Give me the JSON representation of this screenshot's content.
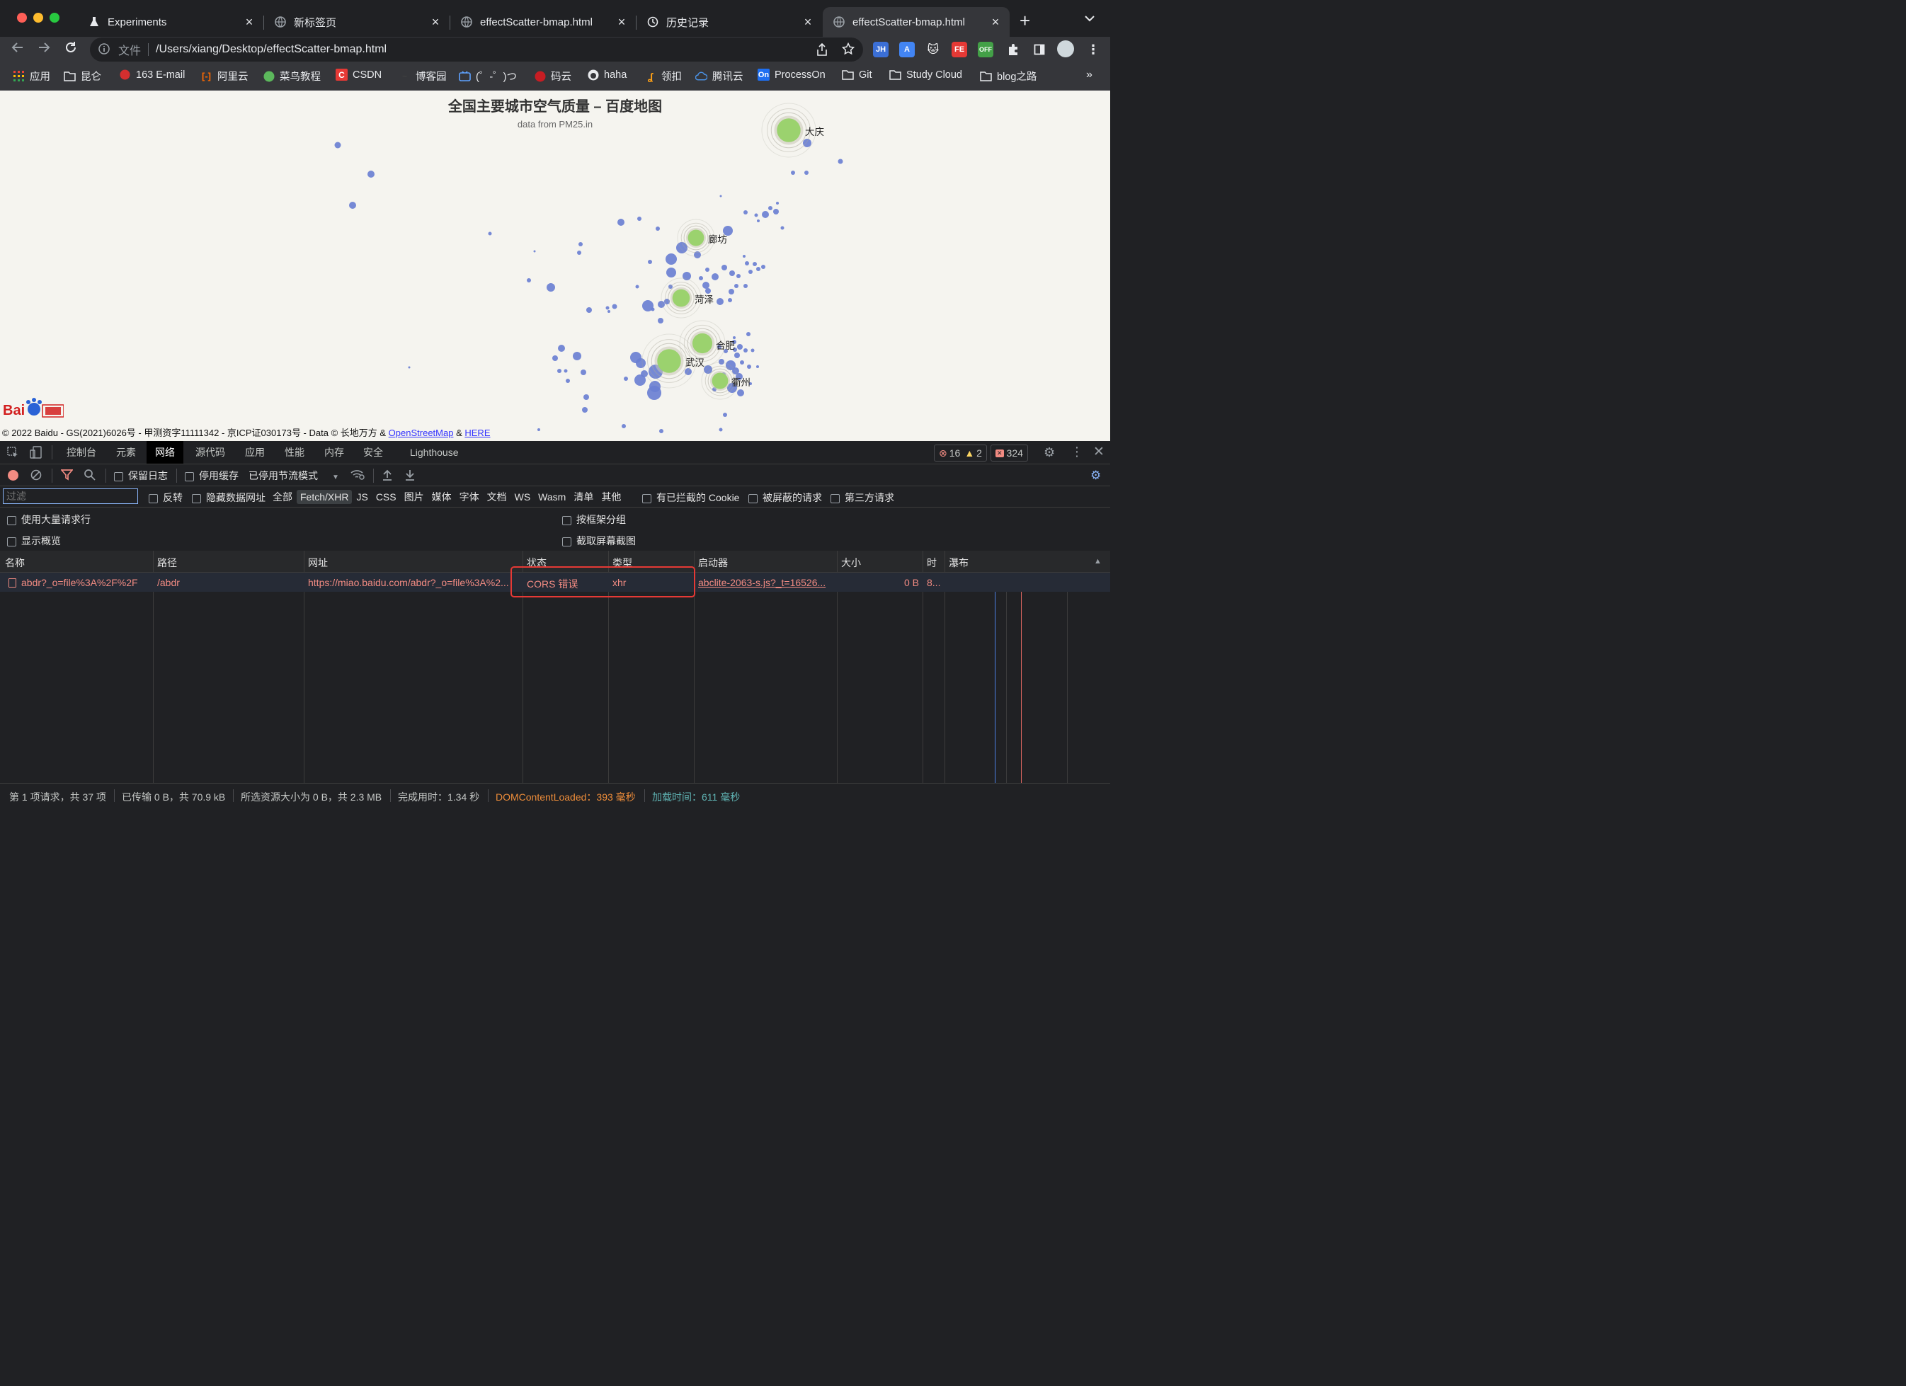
{
  "tabs": [
    {
      "title": "Experiments"
    },
    {
      "title": "新标签页"
    },
    {
      "title": "effectScatter-bmap.html"
    },
    {
      "title": "历史记录"
    },
    {
      "title": "effectScatter-bmap.html"
    }
  ],
  "toolbar": {
    "security_label": "文件",
    "url": "/Users/xiang/Desktop/effectScatter-bmap.html"
  },
  "bookmarks": [
    {
      "label": "应用"
    },
    {
      "label": "昆仑"
    },
    {
      "label": "163 E-mail"
    },
    {
      "label": "阿里云"
    },
    {
      "label": "菜鸟教程"
    },
    {
      "label": "CSDN"
    },
    {
      "label": "博客园"
    },
    {
      "label": "(゜-゜)つ"
    },
    {
      "label": "码云"
    },
    {
      "label": "haha"
    },
    {
      "label": "领扣"
    },
    {
      "label": "腾讯云"
    },
    {
      "label": "ProcessOn"
    },
    {
      "label": "Git"
    },
    {
      "label": "Study Cloud"
    },
    {
      "label": "blog之路"
    }
  ],
  "map": {
    "title": "全国主要城市空气质量 – 百度地图",
    "subtitle": "data from PM25.in",
    "copyright_text": "© 2022 Baidu - GS(2021)6026号 - 甲测资字11111342 - 京ICP证030173号 - Data © 长地万方 &",
    "copyright_link1": "OpenStreetMap",
    "copyright_amp": "&",
    "copyright_link2": "HERE",
    "logo_text": "Bai地图",
    "point_color": "#6a7fd3",
    "highlight_color": "#9bd26e",
    "top_cities": [
      {
        "name": "大庆"
      },
      {
        "name": "廊坊"
      },
      {
        "name": "菏泽"
      },
      {
        "name": "合肥"
      },
      {
        "name": "武汉"
      },
      {
        "name": "衢州"
      }
    ]
  },
  "devtools": {
    "tabs": [
      "控制台",
      "元素",
      "网络",
      "源代码",
      "应用",
      "性能",
      "内存",
      "安全",
      "Lighthouse"
    ],
    "active_tab": "网络",
    "badges": {
      "errors": "16",
      "warnings": "2",
      "issues": "324"
    },
    "network_toolbar": {
      "preserve_log": "保留日志",
      "disable_cache": "停用缓存",
      "throttle": "已停用节流模式"
    },
    "filter": {
      "placeholder": "过滤",
      "invert": "反转",
      "hide_data_urls": "隐藏数据网址",
      "types": [
        "全部",
        "Fetch/XHR",
        "JS",
        "CSS",
        "图片",
        "媒体",
        "字体",
        "文档",
        "WS",
        "Wasm",
        "清单",
        "其他"
      ],
      "active_type": "Fetch/XHR",
      "blocked_cookies": "有已拦截的 Cookie",
      "blocked_requests": "被屏蔽的请求",
      "third_party": "第三方请求"
    },
    "options": {
      "large_rows": "使用大量请求行",
      "group_by_frame": "按框架分组",
      "show_overview": "显示概览",
      "capture_screenshots": "截取屏幕截图"
    },
    "columns": [
      "名称",
      "路径",
      "网址",
      "状态",
      "类型",
      "启动器",
      "大小",
      "时",
      "瀑布"
    ],
    "rows": [
      {
        "name": "abdr?_o=file%3A%2F%2F",
        "path": "/abdr",
        "url": "https://miao.baidu.com/abdr?_o=file%3A%2...",
        "status": "CORS 错误",
        "type": "xhr",
        "initiator": "abclite-2063-s.js?_t=16526...",
        "size": "0 B",
        "time": "8..."
      }
    ],
    "status_bar": {
      "requests": "第 1 项请求，共 37 项",
      "transferred": "已传输 0 B，共 70.9 kB",
      "resources": "所选资源大小为 0 B，共 2.3 MB",
      "finish": "完成用时：1.34 秒",
      "dcl": "DOMContentLoaded：393 毫秒",
      "load": "加载时间：611 毫秒"
    }
  }
}
